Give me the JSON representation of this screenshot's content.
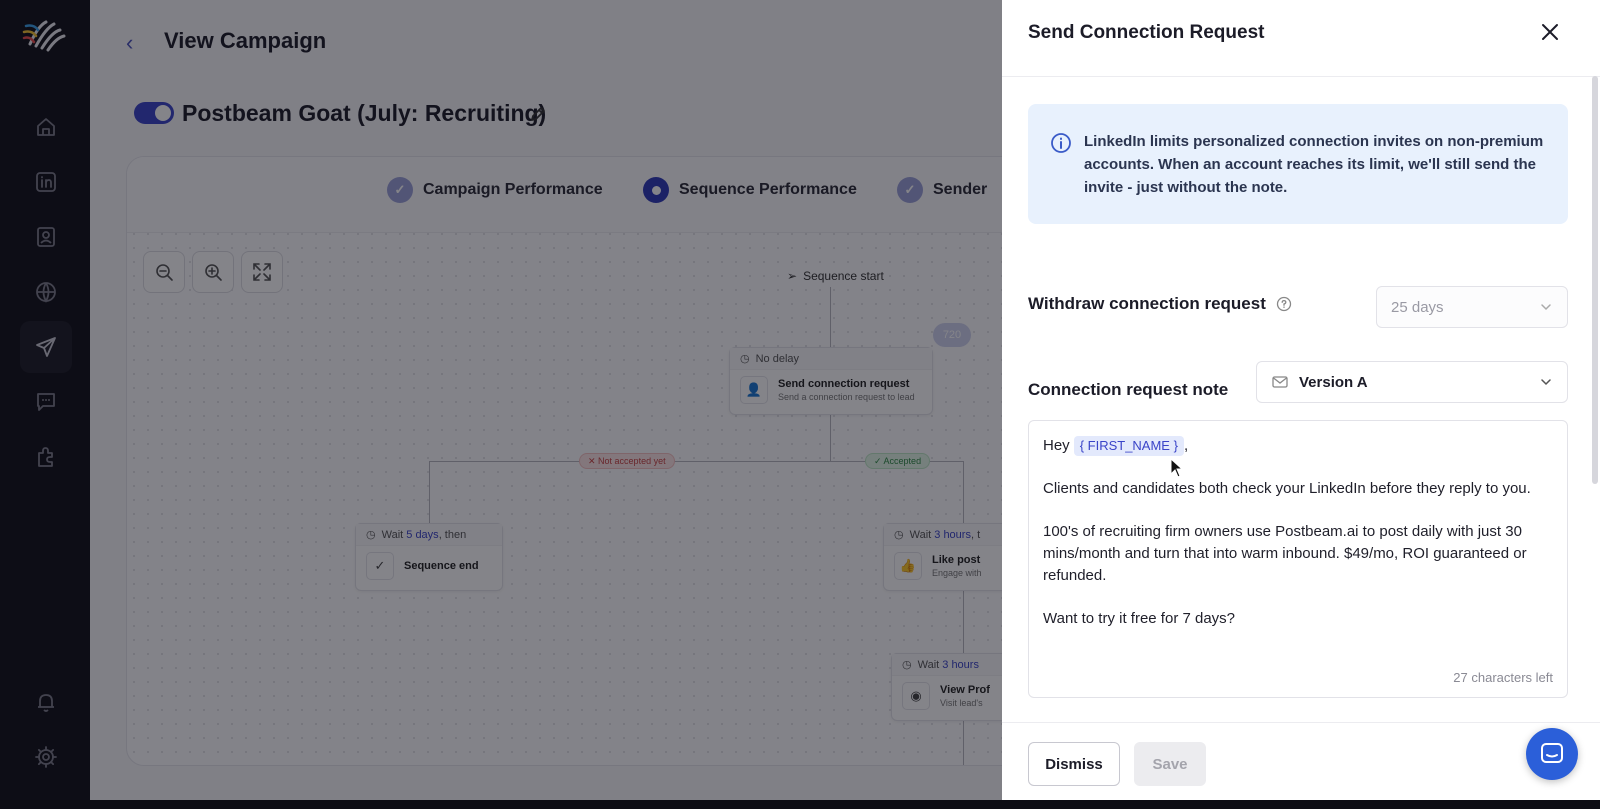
{
  "sidebar": {
    "logo": "hand-wave-logo",
    "items": [
      {
        "icon": "home-icon"
      },
      {
        "icon": "linkedin-icon"
      },
      {
        "icon": "contact-card-icon"
      },
      {
        "icon": "globe-icon"
      },
      {
        "icon": "send-icon",
        "active": true
      },
      {
        "icon": "chat-icon"
      },
      {
        "icon": "puzzle-icon"
      }
    ],
    "bottom_items": [
      {
        "icon": "bell-icon"
      },
      {
        "icon": "gear-icon"
      }
    ]
  },
  "main": {
    "title": "View Campaign",
    "campaign_name": "Postbeam Goat (July: Recruiting)",
    "campaign_enabled": true,
    "tabs": [
      {
        "label": "Campaign Performance",
        "state": "done"
      },
      {
        "label": "Sequence Performance",
        "state": "active"
      },
      {
        "label": "Sender",
        "state": "done"
      }
    ],
    "flow": {
      "start_label": "Sequence start",
      "badge": "720",
      "connection_node": {
        "delay": "No delay",
        "title": "Send connection request",
        "subtitle": "Send a connection request to lead"
      },
      "not_accepted_label": "✕ Not accepted yet",
      "accepted_label": "✓ Accepted",
      "end_node": {
        "delay_prefix": "Wait ",
        "delay_value": "5 days",
        "delay_suffix": ", then",
        "title": "Sequence end"
      },
      "like_node": {
        "delay_prefix": "Wait ",
        "delay_value": "3 hours",
        "delay_suffix": ", t",
        "title": "Like post",
        "subtitle": "Engage with"
      },
      "view_node": {
        "delay_prefix": "Wait ",
        "delay_value": "3 hours",
        "title": "View Prof",
        "subtitle": "Visit lead's"
      }
    }
  },
  "drawer": {
    "title": "Send Connection Request",
    "info_text": "LinkedIn limits personalized connection invites on non-premium accounts. When an account reaches its limit, we'll still send the invite - just without the note.",
    "withdraw_label": "Withdraw connection request",
    "withdraw_value": "25 days",
    "note_label": "Connection request note",
    "note_version": "Version A",
    "note": {
      "greeting": "Hey",
      "variable": "{ FIRST_NAME }",
      "greeting_suffix": ",",
      "paragraph_1": "Clients and candidates both check your LinkedIn before they reply to you.",
      "paragraph_2": "100's of recruiting firm owners use Postbeam.ai to post daily with just 30 mins/month and turn that into warm inbound. $49/mo, ROI guaranteed or refunded.",
      "paragraph_3": "Want to try it free for 7 days?"
    },
    "chars_left": "27 characters left",
    "dismiss_label": "Dismiss",
    "save_label": "Save"
  },
  "colors": {
    "accent": "#3a44c8",
    "info_bg": "#e8f1fd",
    "fab": "#2b5fd9",
    "sidebar_bg": "#111118"
  }
}
